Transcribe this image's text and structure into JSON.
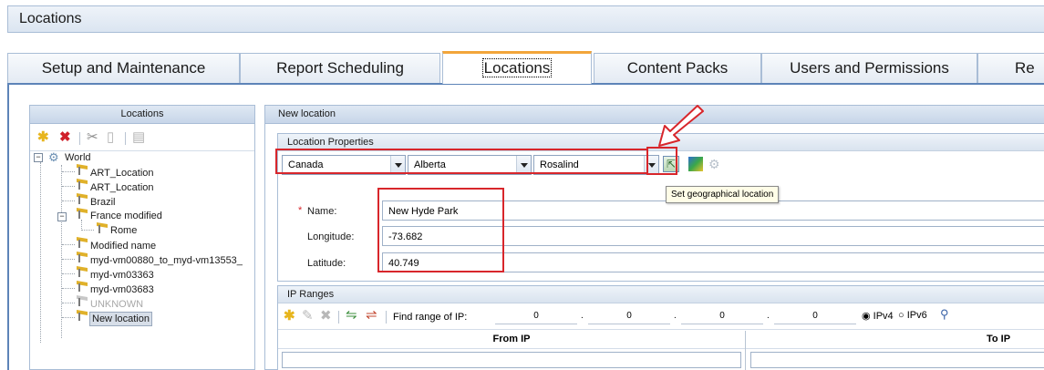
{
  "window": {
    "title": "Locations"
  },
  "tabs": [
    {
      "label": "Setup and Maintenance"
    },
    {
      "label": "Report Scheduling"
    },
    {
      "label": "Locations"
    },
    {
      "label": "Content Packs"
    },
    {
      "label": "Users and Permissions"
    },
    {
      "label": "Re"
    }
  ],
  "left_panel": {
    "title": "Locations",
    "tree": {
      "root": "World",
      "items": [
        "ART_Location",
        "ART_Location",
        "Brazil",
        "France modified",
        "Rome",
        "Modified name",
        "myd-vm00880_to_myd-vm13553_",
        "myd-vm03363",
        "myd-vm03683",
        "UNKNOWN",
        "New location"
      ]
    }
  },
  "right_panel": {
    "title": "New location",
    "location_properties": {
      "title": "Location Properties",
      "country": "Canada",
      "state": "Alberta",
      "city": "Rosalind",
      "tooltip": "Set geographical location",
      "name_label": "Name:",
      "required_mark": "*",
      "name_value": "New Hyde Park",
      "longitude_label": "Longitude:",
      "longitude_value": "-73.682",
      "latitude_label": "Latitude:",
      "latitude_value": "40.749"
    },
    "ip_ranges": {
      "title": "IP Ranges",
      "find_label": "Find range of IP:",
      "octets": [
        "0",
        "0",
        "0",
        "0"
      ],
      "dot": ".",
      "ipv4_label": "IPv4",
      "ipv6_label": "IPv6",
      "columns": [
        "From IP",
        "To IP"
      ]
    }
  },
  "colors": {
    "accent_tab": "#f2a53a",
    "highlight": "#d8262b",
    "panel_border": "#a9bdd6"
  }
}
